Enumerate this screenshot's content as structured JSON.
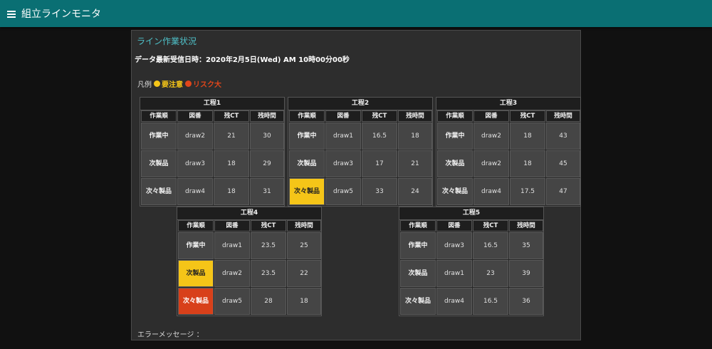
{
  "app": {
    "title": "組立ラインモニタ"
  },
  "panel": {
    "title": "ライン作業状況",
    "timestamp": "データ最新受信日時：2020年2月5日(Wed) AM 10時00分00秒",
    "legend": {
      "label": "凡例",
      "caution": "要注意",
      "risk": "リスク大"
    },
    "error_label": "エラーメッセージ ："
  },
  "colors": {
    "caution": "#f5c518",
    "risk": "#d8401a",
    "header": "#0a6f73"
  },
  "columns": [
    "作業順",
    "図番",
    "残CT",
    "残時間"
  ],
  "processes": [
    {
      "name": "工程1",
      "rows": [
        {
          "order": "作業中",
          "drawing": "draw2",
          "ct": "21",
          "time": "30",
          "status": ""
        },
        {
          "order": "次製品",
          "drawing": "draw3",
          "ct": "18",
          "time": "29",
          "status": ""
        },
        {
          "order": "次々製品",
          "drawing": "draw4",
          "ct": "18",
          "time": "31",
          "status": ""
        }
      ]
    },
    {
      "name": "工程2",
      "rows": [
        {
          "order": "作業中",
          "drawing": "draw1",
          "ct": "16.5",
          "time": "18",
          "status": ""
        },
        {
          "order": "次製品",
          "drawing": "draw3",
          "ct": "17",
          "time": "21",
          "status": ""
        },
        {
          "order": "次々製品",
          "drawing": "draw5",
          "ct": "33",
          "time": "24",
          "status": "caution"
        }
      ]
    },
    {
      "name": "工程3",
      "rows": [
        {
          "order": "作業中",
          "drawing": "draw2",
          "ct": "18",
          "time": "43",
          "status": ""
        },
        {
          "order": "次製品",
          "drawing": "draw2",
          "ct": "18",
          "time": "45",
          "status": ""
        },
        {
          "order": "次々製品",
          "drawing": "draw4",
          "ct": "17.5",
          "time": "47",
          "status": ""
        }
      ]
    },
    {
      "name": "工程4",
      "rows": [
        {
          "order": "作業中",
          "drawing": "draw1",
          "ct": "23.5",
          "time": "25",
          "status": ""
        },
        {
          "order": "次製品",
          "drawing": "draw2",
          "ct": "23.5",
          "time": "22",
          "status": "caution"
        },
        {
          "order": "次々製品",
          "drawing": "draw5",
          "ct": "28",
          "time": "18",
          "status": "risk"
        }
      ]
    },
    {
      "name": "工程5",
      "rows": [
        {
          "order": "作業中",
          "drawing": "draw3",
          "ct": "16.5",
          "time": "35",
          "status": ""
        },
        {
          "order": "次製品",
          "drawing": "draw1",
          "ct": "23",
          "time": "39",
          "status": ""
        },
        {
          "order": "次々製品",
          "drawing": "draw4",
          "ct": "16.5",
          "time": "36",
          "status": ""
        }
      ]
    }
  ]
}
